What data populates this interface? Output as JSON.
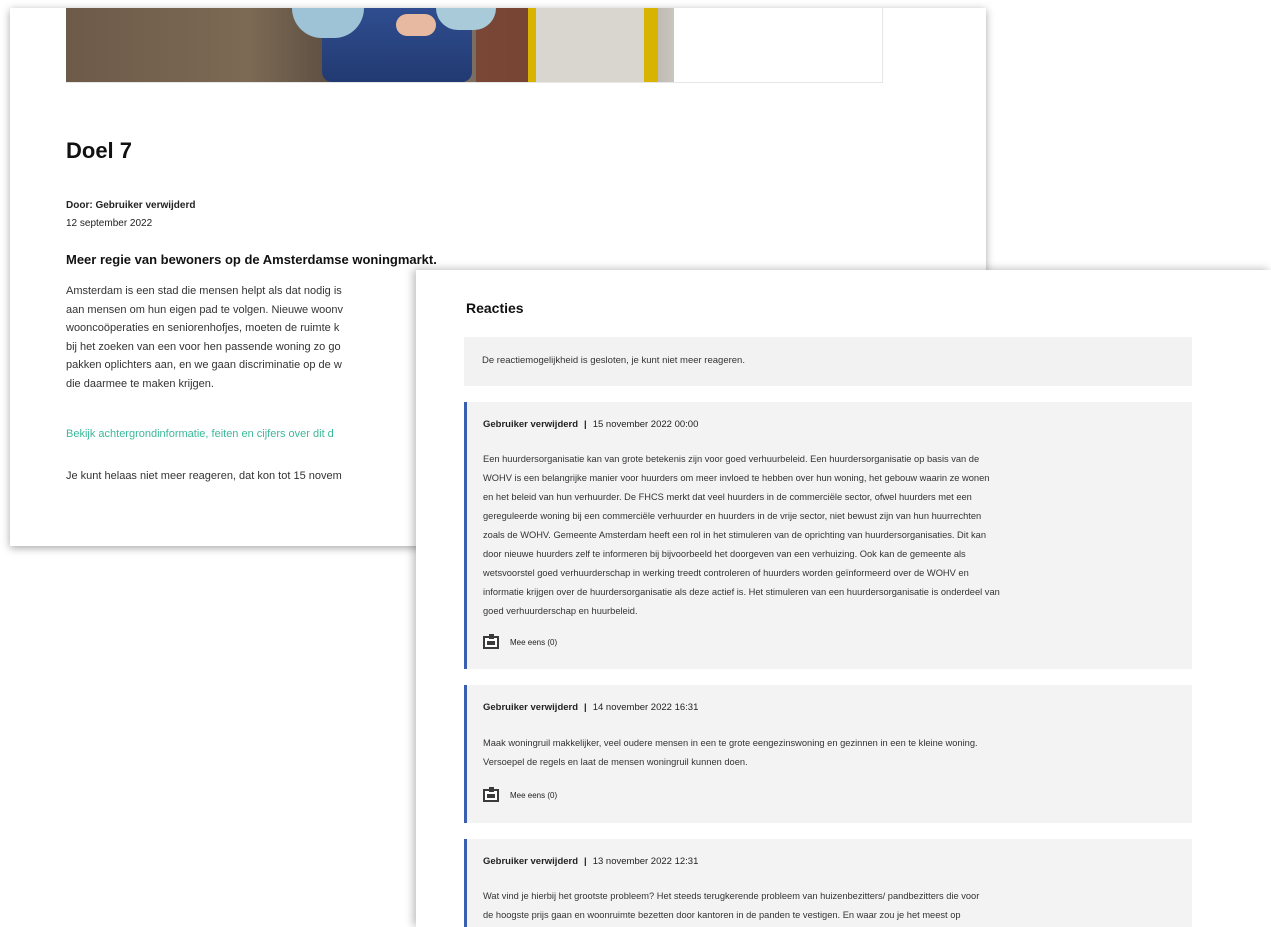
{
  "article": {
    "title": "Doel 7",
    "author": "Door: Gebruiker verwijderd",
    "date": "12 september 2022",
    "intro": "Meer regie van bewoners op de Amsterdamse woningmarkt.",
    "body_lines": [
      "Amsterdam is een stad die mensen helpt als dat nodig is",
      "aan mensen om hun eigen pad te volgen. Nieuwe woonv",
      "wooncoöperaties en seniorenhofjes, moeten de ruimte k",
      "bij het zoeken van een voor hen passende woning zo go",
      "pakken oplichters aan, en we gaan discriminatie op de w",
      "die daarmee te maken krijgen."
    ],
    "more_link": "Bekijk achtergrondinformatie, feiten en cijfers over dit d",
    "closed_note": "Je kunt helaas niet meer reageren, dat kon tot 15 novem"
  },
  "reactions": {
    "title": "Reacties",
    "closed_message": "De reactiemogelijkheid is gesloten, je kunt niet meer reageren.",
    "comments": [
      {
        "author": "Gebruiker verwijderd",
        "separator": "|",
        "date": "15 november 2022 00:00",
        "lines": [
          "Een huurdersorganisatie kan van grote betekenis zijn voor goed verhuurbeleid. Een huurdersorganisatie op basis van de",
          "WOHV is een belangrijke manier voor huurders om meer invloed te hebben over hun woning, het gebouw waarin ze wonen",
          "en het beleid van hun verhuurder. De FHCS merkt dat veel huurders in de commerciële sector, ofwel huurders met een",
          "gereguleerde woning bij een commerciële verhuurder en huurders in de vrije sector, niet bewust zijn van hun huurrechten",
          "zoals de WOHV. Gemeente Amsterdam heeft een rol in het stimuleren van de oprichting van huurdersorganisaties. Dit kan",
          "door nieuwe huurders zelf te informeren bij bijvoorbeeld het doorgeven van een verhuizing. Ook kan de gemeente als",
          "wetsvoorstel goed verhuurderschap in werking treedt controleren of huurders worden geïnformeerd over de WOHV en",
          "informatie krijgen over de huurdersorganisatie als deze actief is. Het stimuleren van een huurdersorganisatie is onderdeel van",
          "goed verhuurderschap en huurbeleid."
        ],
        "agree_label": "Mee eens (0)"
      },
      {
        "author": "Gebruiker verwijderd",
        "separator": "|",
        "date": "14 november 2022 16:31",
        "lines": [
          "Maak woningruil makkelijker, veel oudere mensen in een te grote eengezinswoning en gezinnen in een te kleine woning.",
          "Versoepel de regels en laat de mensen woningruil kunnen doen."
        ],
        "agree_label": "Mee eens (0)"
      },
      {
        "author": "Gebruiker verwijderd",
        "separator": "|",
        "date": "13 november 2022 12:31",
        "lines": [
          "Wat vind je hierbij het grootste probleem? Het steeds terugkerende probleem van huizenbezitters/ pandbezitters die voor",
          "de hoogste prijs gaan en woonruimte bezetten door kantoren in de panden te vestigen. En waar zou je het meest op"
        ],
        "agree_label": ""
      }
    ]
  }
}
